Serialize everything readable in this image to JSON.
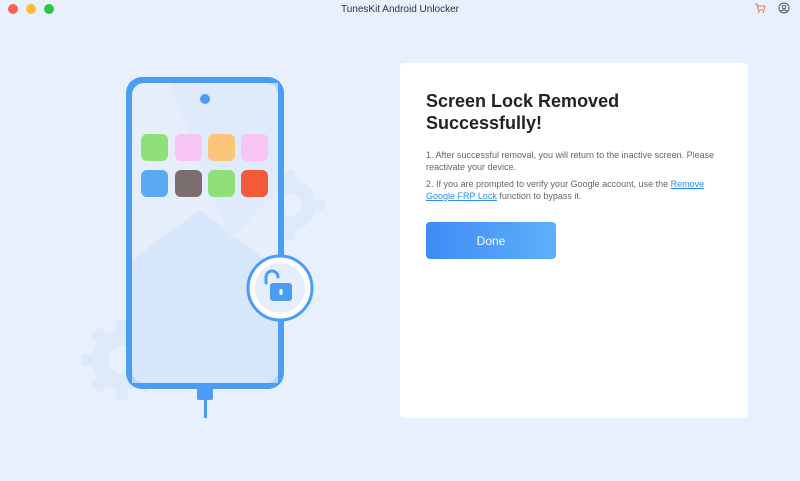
{
  "window": {
    "title": "TunesKit Android Unlocker",
    "icons": [
      "cart-icon",
      "account-icon"
    ]
  },
  "result": {
    "heading": "Screen Lock Removed Successfully!",
    "step1": "1. After successful removal, you will return to the inactive screen. Please reactivate your device.",
    "step2_prefix": "2. If you are prompted to verify your Google account, use the ",
    "step2_link": "Remove Google FRP Lock",
    "step2_suffix": " function to bypass it.",
    "done_label": "Done"
  },
  "colors": {
    "accent": "#3f8bf5",
    "link": "#2f8cf0",
    "background": "#e9f0fd",
    "phone_frame": "#4b9cf5"
  },
  "illustration": {
    "app_icon_colors": [
      "#8fe07a",
      "#f7c4f3",
      "#fcc57a",
      "#f7c4f3",
      "#5aa9f5",
      "#7a6e6e",
      "#8fe07a",
      "#f25a3a"
    ]
  }
}
